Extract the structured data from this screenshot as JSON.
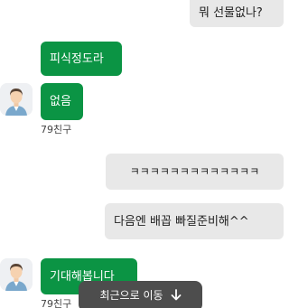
{
  "messages": [
    {
      "from": "me",
      "text": "뭐 선물없나?"
    },
    {
      "from": "them",
      "text": "피식정도라"
    },
    {
      "from": "them",
      "text": "없음",
      "sender": "79친구"
    },
    {
      "from": "me",
      "text": "ㅋㅋㅋㅋㅋㅋㅋㅋㅋㅋㅋㅋㅋ"
    },
    {
      "from": "me",
      "text": "다음엔 배꼽 빠질준비해^^"
    },
    {
      "from": "them",
      "text": "기대해봅니다",
      "sender": "79친구"
    }
  ],
  "jump_button": {
    "label": "최근으로 이동",
    "icon": "arrow-down-icon"
  },
  "colors": {
    "my_bubble": "#e8e8e8",
    "their_bubble": "#0b9444",
    "jump_button": "#4d4d4d"
  }
}
